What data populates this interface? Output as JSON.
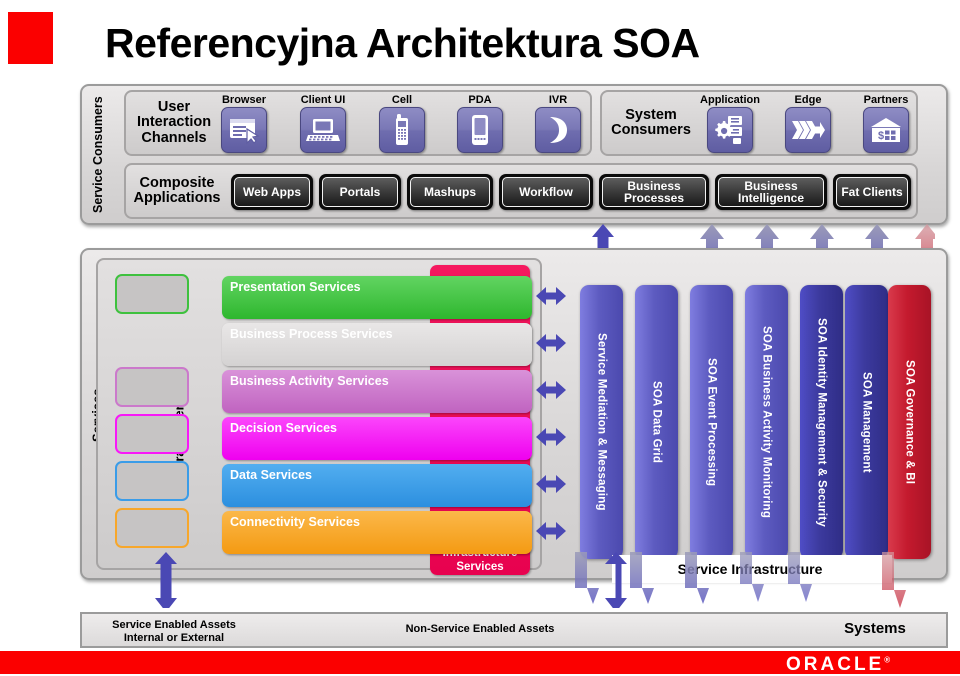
{
  "title": "Referencyjna Architektura SOA",
  "colors": {
    "brand_red": "#fb0000",
    "presentation": "#3ec13e",
    "business_process": "#dedcdc",
    "business_activity": "#cb79cb",
    "decision": "#f818f8",
    "data": "#3a9ce8",
    "connectivity": "#f7a72b",
    "infrastructure": "#ea0350",
    "bar_blue": "#5d5bc0",
    "bar_darkblue": "#3c3a9e",
    "bar_red": "#c41a2e",
    "tile_purple": "#6f6daf"
  },
  "consumers": {
    "side_label": "Service Consumers",
    "ui_channels": {
      "title": "User Interaction Channels",
      "items": [
        {
          "label": "Browser",
          "icon": "browser-icon"
        },
        {
          "label": "Client UI",
          "icon": "laptop-icon"
        },
        {
          "label": "Cell",
          "icon": "cellphone-icon"
        },
        {
          "label": "PDA",
          "icon": "pda-icon"
        },
        {
          "label": "IVR",
          "icon": "phone-handset-icon"
        }
      ]
    },
    "system_consumers": {
      "title": "System Consumers",
      "items": [
        {
          "label": "Application",
          "icon": "server-gear-icon"
        },
        {
          "label": "Edge",
          "icon": "edge-arrow-icon"
        },
        {
          "label": "Partners",
          "icon": "bank-icon"
        }
      ]
    },
    "composite": {
      "title": "Composite Applications",
      "items": [
        {
          "label": "Web Apps"
        },
        {
          "label": "Portals"
        },
        {
          "label": "Mashups"
        },
        {
          "label": "Workflow"
        },
        {
          "label": "Business Processes"
        },
        {
          "label": "Business Intelligence"
        },
        {
          "label": "Fat Clients"
        }
      ]
    }
  },
  "services": {
    "side_label": "Services",
    "federated_label": "Federated Services",
    "infrastructure_label": "Infrastructure Services",
    "rows": [
      {
        "label": "Presentation Services",
        "color": "#3ec13e",
        "federated": true,
        "text": "#ffffff"
      },
      {
        "label": "Business Process Services",
        "color": "#dedcdc",
        "federated": false,
        "text": "#ffffff"
      },
      {
        "label": "Business Activity Services",
        "color": "#cb79cb",
        "federated": true,
        "text": "#ffffff"
      },
      {
        "label": "Decision Services",
        "color": "#f818f8",
        "federated": true,
        "text": "#ffffff"
      },
      {
        "label": "Data Services",
        "color": "#3a9ce8",
        "federated": true,
        "text": "#ffffff"
      },
      {
        "label": "Connectivity Services",
        "color": "#f7a72b",
        "federated": true,
        "text": "#ffffff"
      }
    ]
  },
  "infrastructure": {
    "caption": "Service Infrastructure",
    "bars": [
      {
        "label": "Service Mediation & Messaging",
        "color": "blue"
      },
      {
        "label": "SOA Data Grid",
        "color": "blue"
      },
      {
        "label": "SOA Event Processing",
        "color": "blue"
      },
      {
        "label": "SOA Business Activity Monitoring",
        "color": "blue"
      },
      {
        "label": "SOA Identity Management & Security",
        "color": "darkblue"
      },
      {
        "label": "SOA Management",
        "color": "darkblue"
      },
      {
        "label": "SOA Governance & BI",
        "color": "red"
      }
    ]
  },
  "assets": {
    "service_enabled": "Service Enabled Assets Internal or External",
    "service_enabled_line1": "Service Enabled Assets",
    "service_enabled_line2": "Internal or External",
    "non_service_enabled": "Non-Service Enabled Assets",
    "systems": "Systems"
  },
  "footer": {
    "logo": "ORACLE",
    "tm": "®"
  }
}
